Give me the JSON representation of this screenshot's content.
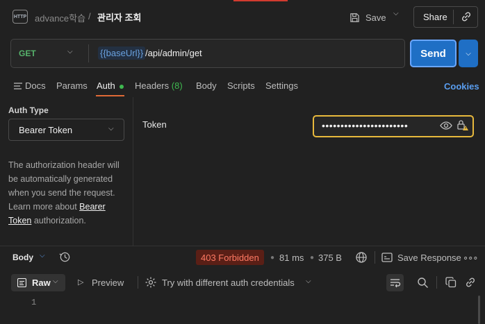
{
  "header": {
    "breadcrumb_parent": "advance학습",
    "breadcrumb_sep": "/",
    "breadcrumb_current": "관리자 조회",
    "save_label": "Save",
    "share_label": "Share",
    "http_icon_text": "HTTP"
  },
  "request": {
    "method": "GET",
    "url_variable": "{{baseUrl}}",
    "url_path": "/api/admin/get",
    "send_label": "Send"
  },
  "tabs": [
    {
      "label": "Docs"
    },
    {
      "label": "Params"
    },
    {
      "label": "Auth"
    },
    {
      "label": "Headers",
      "count": "(8)"
    },
    {
      "label": "Body"
    },
    {
      "label": "Scripts"
    },
    {
      "label": "Settings"
    }
  ],
  "cookies_label": "Cookies",
  "auth": {
    "type_label": "Auth Type",
    "type_value": "Bearer Token",
    "description": "The authorization header will be automatically generated when you send the request. Learn more about",
    "link_text": "Bearer Token",
    "description_end": "authorization.",
    "token_label": "Token",
    "token_masked": "•••••••••••••••••••••••"
  },
  "response": {
    "body_label": "Body",
    "status": "403 Forbidden",
    "time": "81 ms",
    "size": "375 B",
    "save_response_label": "Save Response",
    "more": "∘∘∘",
    "status_color": "#ff7a64"
  },
  "toolbar": {
    "raw_label": "Raw",
    "preview_label": "Preview",
    "try_label": "Try with different auth credentials"
  },
  "editor": {
    "line_number": "1"
  }
}
